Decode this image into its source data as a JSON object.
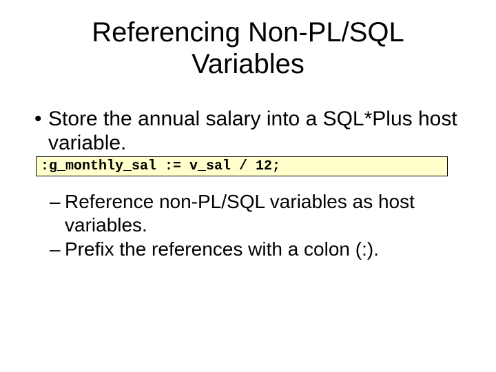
{
  "title": "Referencing Non-PL/SQL Variables",
  "bullet": {
    "marker": "•",
    "text": "Store the annual salary into a SQL*Plus host variable."
  },
  "code": ":g_monthly_sal := v_sal / 12;",
  "subBullets": [
    {
      "marker": "–",
      "text": "Reference non-PL/SQL variables as host variables."
    },
    {
      "marker": "–",
      "text": "Prefix the references with a colon (:)."
    }
  ]
}
